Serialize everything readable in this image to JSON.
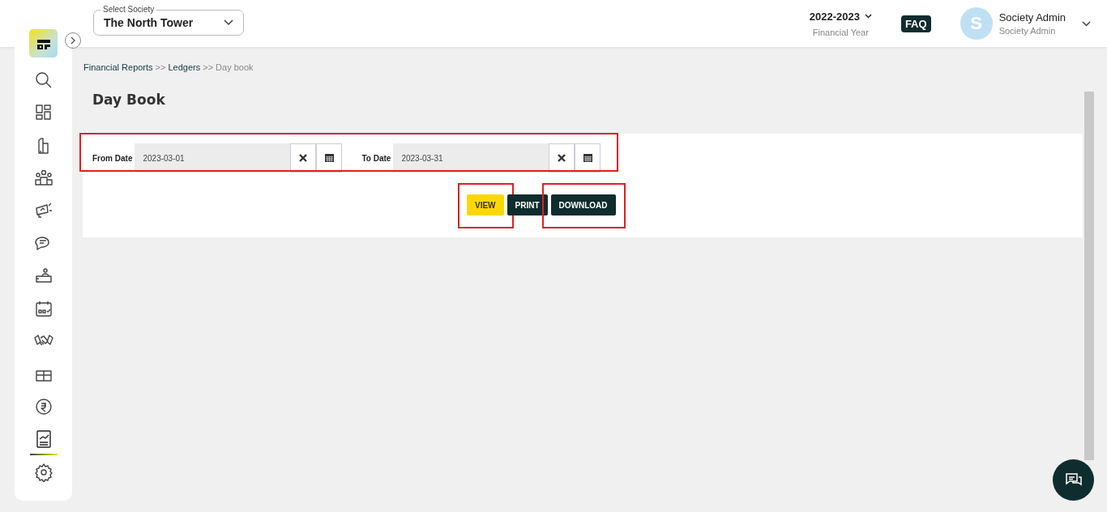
{
  "header": {
    "society_label": "Select Society",
    "society": "The North Tower",
    "financial_year": "2022-2023",
    "financial_year_label": "Financial Year",
    "faq": "FAQ",
    "user_initial": "S",
    "user_name": "Society Admin",
    "user_role": "Society Admin"
  },
  "sidebar": {
    "items": [
      {
        "selected": false
      },
      {
        "selected": false
      },
      {
        "selected": false
      },
      {
        "selected": false
      },
      {
        "selected": false
      },
      {
        "selected": false
      },
      {
        "selected": false
      },
      {
        "selected": false
      },
      {
        "selected": false
      },
      {
        "selected": false
      },
      {
        "selected": false
      },
      {
        "selected": true
      },
      {
        "selected": false
      }
    ]
  },
  "breadcrumb": [
    {
      "label": "Financial Reports",
      "kind": "link"
    },
    {
      "label": ">>",
      "kind": "separator"
    },
    {
      "label": "Ledgers",
      "kind": "link"
    },
    {
      "label": ">>",
      "kind": "separator"
    },
    {
      "label": "Day book",
      "kind": "current"
    }
  ],
  "page_title": "Day Book",
  "filters": {
    "highlighted": true,
    "fields": [
      {
        "label": "From Date",
        "value": "2023-03-01"
      },
      {
        "label": "To Date",
        "value": "2023-03-31"
      }
    ]
  },
  "buttons": [
    {
      "label": "VIEW",
      "kind": "primary",
      "highlighted": true
    },
    {
      "label": "PRINT",
      "kind": "dark",
      "highlighted": false
    },
    {
      "label": "DOWNLOAD",
      "kind": "dark",
      "highlighted": true
    }
  ]
}
